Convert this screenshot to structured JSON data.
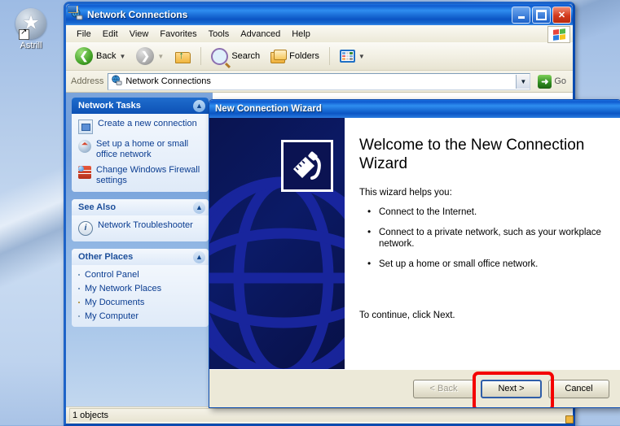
{
  "desktop": {
    "icon": {
      "label": "Astrill",
      "icon": "astrill-star-icon"
    }
  },
  "explorer": {
    "title": "Network Connections",
    "title_icon": "network-globe-icon",
    "caption_buttons": {
      "minimize": "Minimize",
      "maximize": "Maximize",
      "close": "Close"
    },
    "menus": [
      "File",
      "Edit",
      "View",
      "Favorites",
      "Tools",
      "Advanced",
      "Help"
    ],
    "toolbar": {
      "back": "Back",
      "forward": "Forward",
      "up": "Up",
      "search": "Search",
      "folders": "Folders",
      "views": "Views"
    },
    "address": {
      "label": "Address",
      "value": "Network Connections",
      "icon": "network-globe-icon",
      "go": "Go"
    },
    "sidebar": {
      "panels": [
        {
          "title": "Network Tasks",
          "style": "blue",
          "items": [
            {
              "label": "Create a new connection",
              "icon": "new-connection-icon"
            },
            {
              "label": "Set up a home or small office network",
              "icon": "home-network-icon"
            },
            {
              "label": "Change Windows Firewall settings",
              "icon": "firewall-icon"
            }
          ]
        },
        {
          "title": "See Also",
          "style": "plain",
          "items": [
            {
              "label": "Network Troubleshooter",
              "icon": "info-icon"
            }
          ]
        },
        {
          "title": "Other Places",
          "style": "plain",
          "items": [
            {
              "label": "Control Panel",
              "icon": "control-panel-icon"
            },
            {
              "label": "My Network Places",
              "icon": "my-network-places-icon"
            },
            {
              "label": "My Documents",
              "icon": "my-documents-icon"
            },
            {
              "label": "My Computer",
              "icon": "my-computer-icon"
            }
          ]
        }
      ]
    },
    "status": {
      "text": "1 objects"
    }
  },
  "wizard": {
    "title": "New Connection Wizard",
    "heading": "Welcome to the New Connection Wizard",
    "intro": "This wizard helps you:",
    "bullets": [
      "Connect to the Internet.",
      "Connect to a private network, such as your workplace network.",
      "Set up a home or small office network."
    ],
    "continue_text": "To continue, click Next.",
    "banner_icon": "network-plug-icon",
    "buttons": {
      "back": "< Back",
      "next": "Next >",
      "cancel": "Cancel"
    },
    "highlight_color": "#f40000"
  }
}
